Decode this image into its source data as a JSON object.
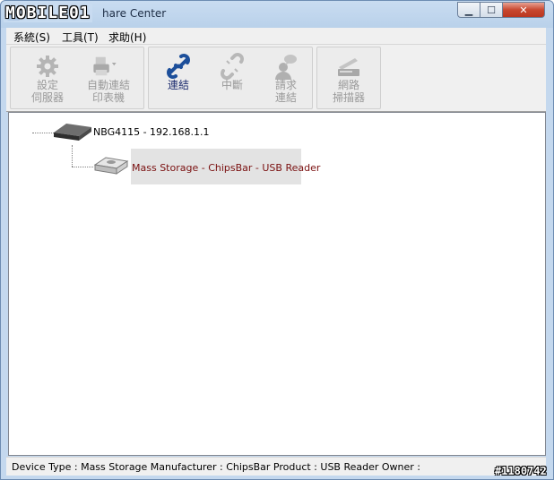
{
  "window": {
    "title": "hare Center",
    "watermark": "MOBILE01"
  },
  "menu": [
    {
      "label": "系統(S)"
    },
    {
      "label": "工具(T)"
    },
    {
      "label": "求助(H)"
    }
  ],
  "toolbar": {
    "setup_server": "設定\n伺服器",
    "auto_connect_printer": "自動連結\n印表機",
    "connect": "連結",
    "disconnect": "中斷",
    "request_connect": "請求\n連結",
    "network_scanner": "網路\n掃描器"
  },
  "tree": {
    "root": "NBG4115 - 192.168.1.1",
    "child": "Mass Storage - ChipsBar - USB Reader"
  },
  "status": {
    "text": "Device Type : Mass Storage   Manufacturer : ChipsBar   Product : USB Reader   Owner :"
  },
  "watermark_id": "#1180742",
  "colors": {
    "child_label": "#7a1010",
    "enabled_label": "#1c2b6e",
    "disabled_label": "#9a9a9a"
  }
}
